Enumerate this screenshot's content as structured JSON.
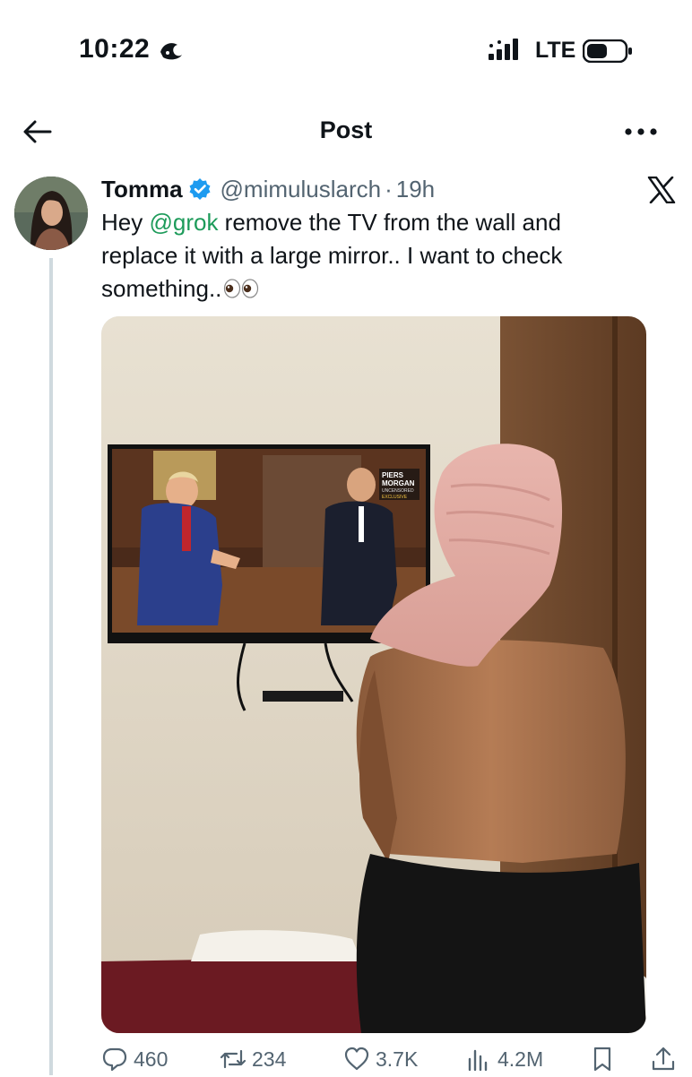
{
  "status_bar": {
    "time": "10:22",
    "network": "LTE"
  },
  "header": {
    "title": "Post"
  },
  "tweet": {
    "display_name": "Tomma",
    "username": "@mimuluslarch",
    "separator": "·",
    "timestamp": "19h",
    "text_before_mention": "Hey ",
    "mention": "@grok",
    "text_after_mention": " remove the TV from the wall and replace it with a large mirror.. I want to check something..",
    "emoji": "eyes"
  },
  "media": {
    "tv_channel_lines": [
      "PIERS",
      "MORGAN",
      "UNCENSORED",
      "EXCLUSIVE"
    ]
  },
  "actions": {
    "replies": "460",
    "reposts": "234",
    "likes": "3.7K",
    "views": "4.2M"
  },
  "colors": {
    "mention": "#1d9b5a",
    "verified": "#1d9bf0",
    "secondary_text": "#536471"
  }
}
